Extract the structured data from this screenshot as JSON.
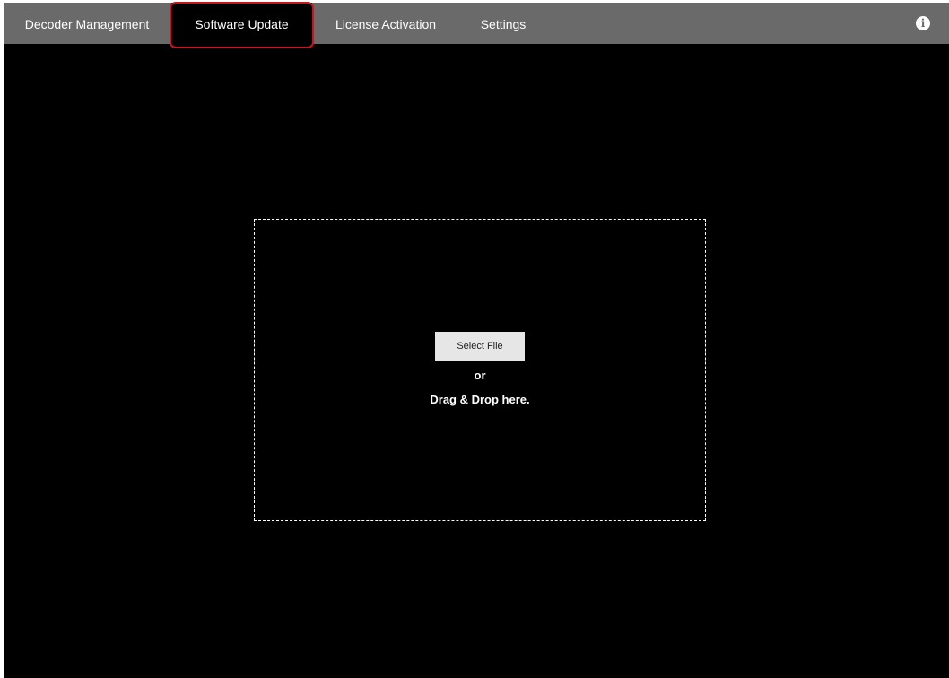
{
  "nav": {
    "tabs": [
      {
        "label": "Decoder Management",
        "active": false
      },
      {
        "label": "Software Update",
        "active": true
      },
      {
        "label": "License Activation",
        "active": false
      },
      {
        "label": "Settings",
        "active": false
      }
    ],
    "info_icon": {
      "icon": "info-icon",
      "glyph": "i"
    }
  },
  "upload": {
    "select_button": "Select File",
    "or_text": "or",
    "drop_text": "Drag & Drop here."
  },
  "colors": {
    "topbar": "#6a6a6a",
    "background": "#000000",
    "active_tab": "#000000",
    "highlight": "#c4161c"
  }
}
